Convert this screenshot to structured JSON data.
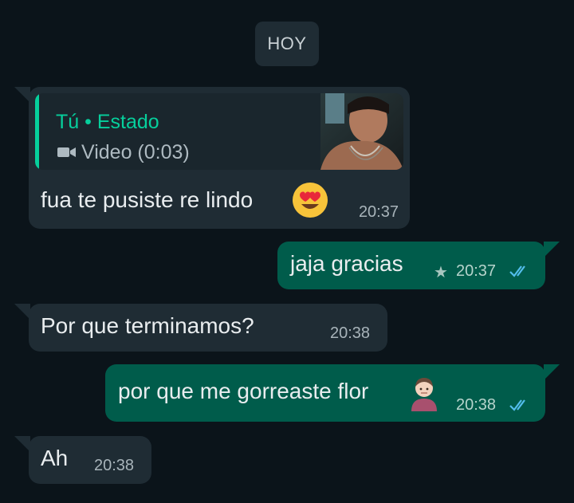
{
  "date_chip": "HOY",
  "messages": [
    {
      "quote": {
        "title": "Tú • Estado",
        "subtitle": "Video (0:03)"
      },
      "text": "fua te pusiste re lindo",
      "time": "20:37"
    },
    {
      "text": "jaja gracias",
      "time": "20:37"
    },
    {
      "text": "Por que terminamos?",
      "time": "20:38"
    },
    {
      "text": "por que me gorreaste flor",
      "time": "20:38"
    },
    {
      "text": "Ah",
      "time": "20:38"
    }
  ],
  "colors": {
    "background": "#0b141a",
    "incoming_bubble": "#1f2c34",
    "outgoing_bubble": "#005c4b",
    "accent": "#06cf9c",
    "read_ticks": "#53bdeb"
  },
  "icons": [
    "video-camera-icon",
    "heart-eyes-emoji",
    "star-icon",
    "double-check-icon",
    "person-emoji"
  ]
}
